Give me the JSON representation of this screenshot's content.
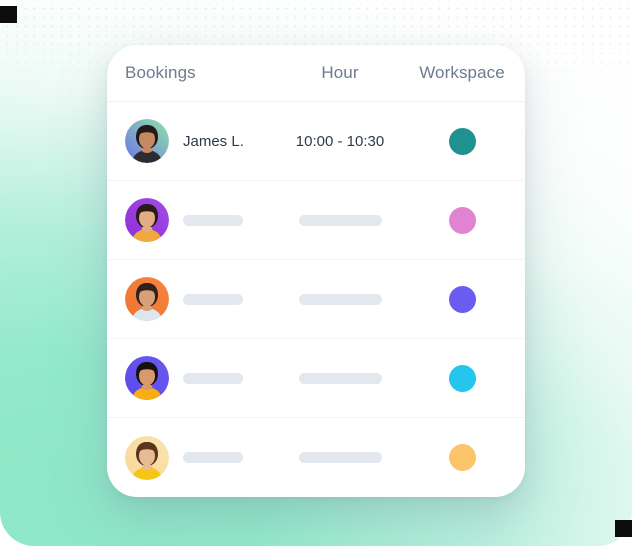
{
  "theme": {
    "background_start": "#8EE7C8",
    "background_end": "#F7FDFB",
    "card_background": "#FFFFFF",
    "header_text_color": "#6C7B8E",
    "body_text_color": "#2C3A4B",
    "skeleton_color": "#E3E7EE",
    "row_divider_color": "#F2F4F7"
  },
  "table": {
    "columns": [
      {
        "key": "bookings",
        "label": "Bookings"
      },
      {
        "key": "hour",
        "label": "Hour"
      },
      {
        "key": "workspace",
        "label": "Workspace"
      }
    ],
    "rows": [
      {
        "avatar_name": "avatar-james-l",
        "avatar_bg_from": "#8FE3A8",
        "avatar_bg_to": "#6F74E8",
        "skin": "#C68A62",
        "hair": "#241B17",
        "shirt": "#2B2B31",
        "name": "James L.",
        "hour": "10:00 - 10:30",
        "loading": false,
        "workspace_color": "#1F918F",
        "workspace_name": "workspace-dot-teal"
      },
      {
        "avatar_name": "avatar-person-2",
        "avatar_bg_from": "#A34BE8",
        "avatar_bg_to": "#8E2FD8",
        "skin": "#E2AC84",
        "hair": "#2A1A18",
        "shirt": "#F2A83C",
        "name": "",
        "hour": "",
        "loading": true,
        "workspace_color": "#E083D1",
        "workspace_name": "workspace-dot-pink"
      },
      {
        "avatar_name": "avatar-person-3",
        "avatar_bg_from": "#F5833E",
        "avatar_bg_to": "#EE7530",
        "skin": "#D9A078",
        "hair": "#30211B",
        "shirt": "#DCE6EF",
        "name": "",
        "hour": "",
        "loading": true,
        "workspace_color": "#6A5CF0",
        "workspace_name": "workspace-dot-violet"
      },
      {
        "avatar_name": "avatar-person-4",
        "avatar_bg_from": "#6B5AF0",
        "avatar_bg_to": "#5A49E8",
        "skin": "#D9996E",
        "hair": "#17120F",
        "shirt": "#F5AE14",
        "name": "",
        "hour": "",
        "loading": true,
        "workspace_color": "#25C5ED",
        "workspace_name": "workspace-dot-cyan"
      },
      {
        "avatar_name": "avatar-person-5",
        "avatar_bg_from": "#FBE2AE",
        "avatar_bg_to": "#F7D99A",
        "skin": "#E9BB94",
        "hair": "#5A3520",
        "shirt": "#F5C518",
        "name": "",
        "hour": "",
        "loading": true,
        "workspace_color": "#FCC46B",
        "workspace_name": "workspace-dot-amber"
      }
    ]
  }
}
